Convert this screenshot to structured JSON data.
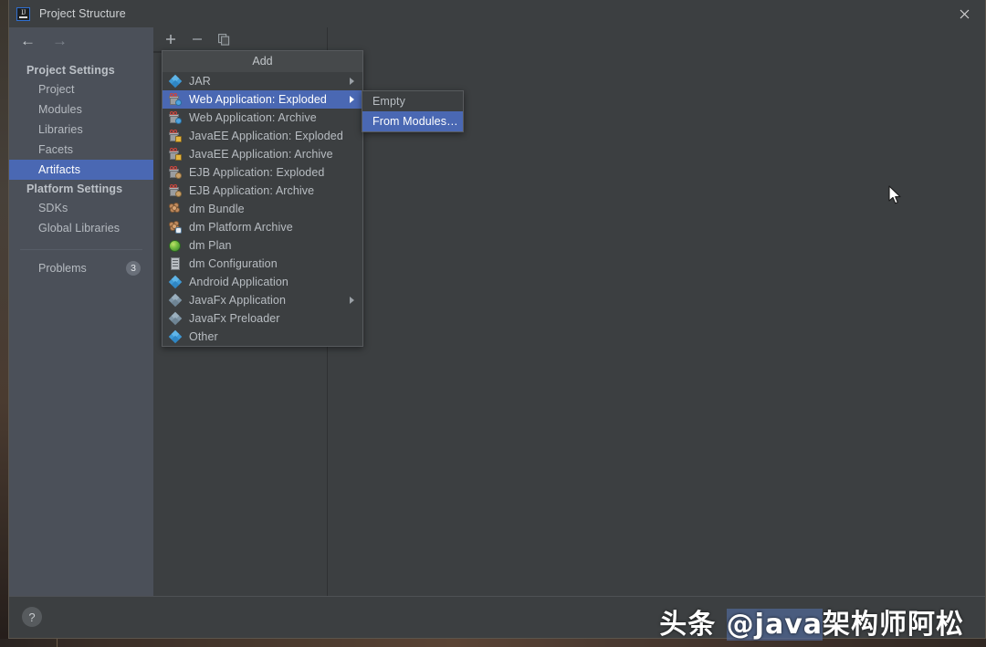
{
  "window": {
    "title": "Project Structure",
    "app_icon": "intellij-idea-icon",
    "close_label": "✕"
  },
  "sidebar": {
    "back_icon": "arrow-left-icon",
    "forward_icon": "arrow-right-icon",
    "groups": [
      {
        "label": "Project Settings",
        "items": [
          {
            "label": "Project",
            "selected": false
          },
          {
            "label": "Modules",
            "selected": false
          },
          {
            "label": "Libraries",
            "selected": false
          },
          {
            "label": "Facets",
            "selected": false
          },
          {
            "label": "Artifacts",
            "selected": true
          }
        ]
      },
      {
        "label": "Platform Settings",
        "items": [
          {
            "label": "SDKs",
            "selected": false
          },
          {
            "label": "Global Libraries",
            "selected": false
          }
        ]
      }
    ],
    "problems": {
      "label": "Problems",
      "count": "3"
    }
  },
  "toolbar": {
    "add_icon": "plus-icon",
    "remove_icon": "minus-icon",
    "copy_icon": "copy-icon"
  },
  "menu": {
    "title": "Add",
    "items": [
      {
        "label": "JAR",
        "icon": "diamond-blue-icon",
        "selected": false,
        "submenu": true
      },
      {
        "label": "Web Application: Exploded",
        "icon": "gift-box-blue-chip-icon",
        "selected": true,
        "submenu": true
      },
      {
        "label": "Web Application: Archive",
        "icon": "gift-box-blue-chip-icon",
        "selected": false,
        "submenu": false
      },
      {
        "label": "JavaEE Application: Exploded",
        "icon": "gift-box-yellow-chip-icon",
        "selected": false,
        "submenu": false
      },
      {
        "label": "JavaEE Application: Archive",
        "icon": "gift-box-yellow-chip-icon",
        "selected": false,
        "submenu": false
      },
      {
        "label": "EJB Application: Exploded",
        "icon": "gift-box-tan-chip-icon",
        "selected": false,
        "submenu": false
      },
      {
        "label": "EJB Application: Archive",
        "icon": "gift-box-tan-chip-icon",
        "selected": false,
        "submenu": false
      },
      {
        "label": "dm Bundle",
        "icon": "bundle-cluster-icon",
        "selected": false,
        "submenu": false
      },
      {
        "label": "dm Platform Archive",
        "icon": "bundle-cluster-badge-icon",
        "selected": false,
        "submenu": false
      },
      {
        "label": "dm Plan",
        "icon": "globe-green-icon",
        "selected": false,
        "submenu": false
      },
      {
        "label": "dm Configuration",
        "icon": "document-icon",
        "selected": false,
        "submenu": false
      },
      {
        "label": "Android Application",
        "icon": "diamond-blue-icon",
        "selected": false,
        "submenu": false
      },
      {
        "label": "JavaFx Application",
        "icon": "diamond-gray-icon",
        "selected": false,
        "submenu": true
      },
      {
        "label": "JavaFx Preloader",
        "icon": "diamond-gray-icon",
        "selected": false,
        "submenu": false
      },
      {
        "label": "Other",
        "icon": "diamond-blue-icon",
        "selected": false,
        "submenu": false
      }
    ]
  },
  "submenu": {
    "items": [
      {
        "label": "Empty",
        "selected": false
      },
      {
        "label": "From Modules…",
        "selected": true
      }
    ]
  },
  "bottombar": {
    "help_label": "?"
  },
  "watermark": {
    "prefix": "头条 ",
    "handle": "@java",
    "suffix": "架构师阿松"
  },
  "colors": {
    "accent": "#4a68b3",
    "window_bg": "#3c3f41",
    "sidebar_bg": "#4b5059",
    "text": "#b6bbc1"
  }
}
